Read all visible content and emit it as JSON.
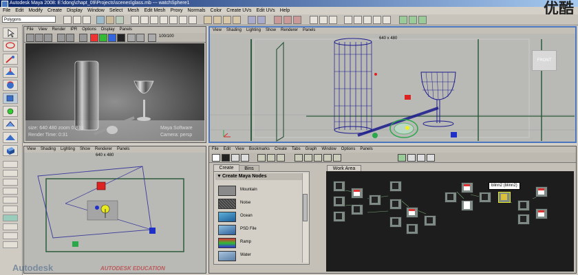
{
  "window": {
    "title": "Autodesk Maya 2008: E:\\dong\\chapt_09\\Projects\\scenes\\glass.mb  ---  watchSphere1"
  },
  "watermark": "优酷",
  "menubar": [
    "File",
    "Edit",
    "Modify",
    "Create",
    "Display",
    "Window",
    "Select",
    "Mesh",
    "Edit Mesh",
    "Proxy",
    "Normals",
    "Color",
    "Create UVs",
    "Edit UVs",
    "Help"
  ],
  "shelf": {
    "mode": "Polygons"
  },
  "render_view": {
    "menu": [
      "File",
      "View",
      "Render",
      "IPR",
      "Options",
      "Display",
      "Panels"
    ],
    "frame_label": "100/100",
    "status_line1": "size: 640 480 zoom 0.833",
    "status_line2": "Render Time: 0:31",
    "status_right1": "Maya Software",
    "status_right2": "Camera: persp"
  },
  "persp_view": {
    "menu": [
      "View",
      "Shading",
      "Lighting",
      "Show",
      "Renderer",
      "Panels"
    ],
    "resolution": "640 x 480",
    "front_cube_label": "FRONT"
  },
  "top_view": {
    "menu": [
      "View",
      "Shading",
      "Lighting",
      "Show",
      "Renderer",
      "Panels"
    ],
    "resolution": "640 x 480"
  },
  "hypershade": {
    "menu": [
      "File",
      "Edit",
      "View",
      "Bookmarks",
      "Create",
      "Tabs",
      "Graph",
      "Window",
      "Options",
      "Panels"
    ],
    "tabs": [
      "Create",
      "Bins"
    ],
    "work_area_tab": "Work Area",
    "section_title": "Create Maya Nodes",
    "nodes": [
      {
        "label": "Mountain",
        "color": "#8a8a8a"
      },
      {
        "label": "Noise",
        "color": "#4a4a4a"
      },
      {
        "label": "Ocean",
        "color": "#2f7bb3"
      },
      {
        "label": "PSD File",
        "color": "#3e6fa3"
      },
      {
        "label": "Ramp",
        "color": "#3cb04a"
      },
      {
        "label": "Water",
        "color": "#6a8fb5"
      }
    ],
    "tooltip": "blinn2 (blinn2)"
  },
  "footer": {
    "brand_left": "Autodesk",
    "brand_right": "AUTODESK EDUCATION"
  },
  "colors": {
    "title_bar": "#0a246a",
    "viewport_bg": "#b9b9b6",
    "hypershade_bg": "#1d1d1d",
    "wire_blue": "#1a1a8c",
    "selection_green": "#2aa84a"
  }
}
